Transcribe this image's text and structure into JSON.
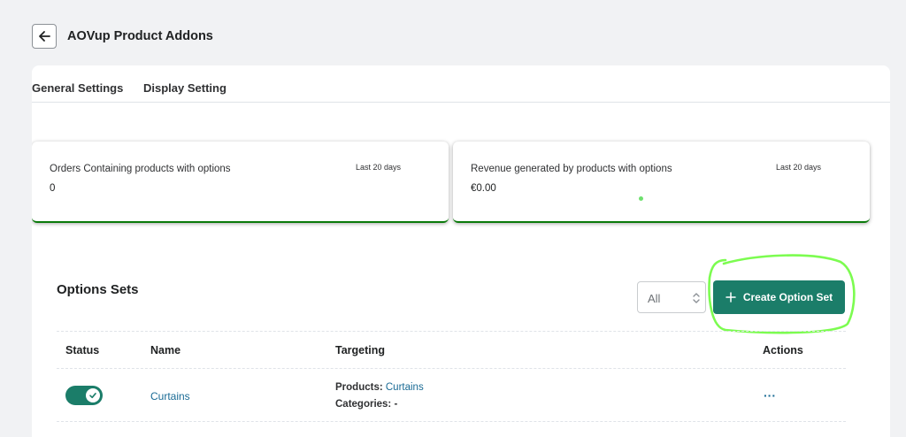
{
  "header": {
    "title": "AOVup Product Addons"
  },
  "tabs": [
    {
      "label": "General Settings"
    },
    {
      "label": "Display Setting"
    }
  ],
  "stats": [
    {
      "label": "Orders Containing products with options",
      "period": "Last 20 days",
      "value": "0"
    },
    {
      "label": "Revenue generated by products with options",
      "period": "Last 20 days",
      "value": "€0.00"
    }
  ],
  "options": {
    "title": "Options Sets",
    "filter": {
      "value": "All"
    },
    "create_label": "Create Option Set",
    "columns": [
      "Status",
      "Name",
      "Targeting",
      "Actions"
    ],
    "rows": [
      {
        "enabled": true,
        "name": "Curtains",
        "products_label": "Products:",
        "products_value": "Curtains",
        "categories_label": "Categories:",
        "categories_value": "-",
        "actions_label": "···"
      }
    ]
  },
  "colors": {
    "accent": "#1b7d69",
    "link": "#1a6b95",
    "card_border": "#0a7a0a",
    "highlight": "#7CFC50"
  }
}
